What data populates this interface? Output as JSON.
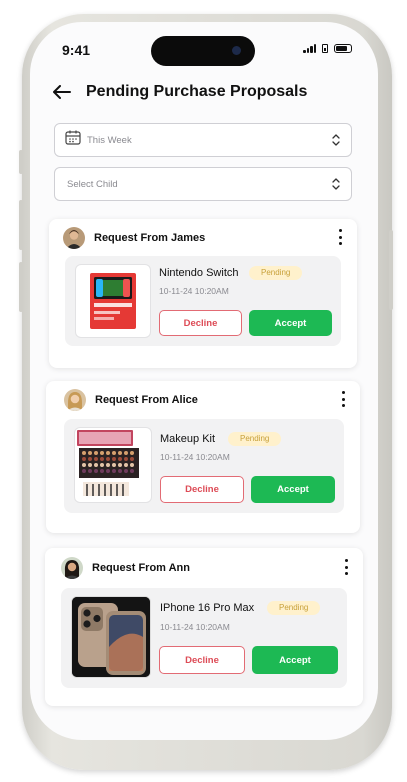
{
  "status_bar": {
    "time": "9:41"
  },
  "header": {
    "title": "Pending Purchase Proposals"
  },
  "filters": {
    "week": {
      "value": "This Week"
    },
    "child": {
      "placeholder": "Select Child"
    }
  },
  "requests": [
    {
      "requester": "Request From James",
      "product": "Nintendo Switch",
      "status": "Pending",
      "datetime": "10-11-24 10:20AM",
      "decline_label": "Decline",
      "accept_label": "Accept"
    },
    {
      "requester": "Request From Alice",
      "product": "Makeup Kit",
      "status": "Pending",
      "datetime": "10-11-24 10:20AM",
      "decline_label": "Decline",
      "accept_label": "Accept"
    },
    {
      "requester": "Request From Ann",
      "product": "IPhone 16 Pro Max",
      "status": "Pending",
      "datetime": "10-11-24 10:20AM",
      "decline_label": "Decline",
      "accept_label": "Accept"
    }
  ],
  "colors": {
    "accept": "#1db954",
    "decline": "#dd4b56",
    "pending_bg": "#fff1cc",
    "pending_text": "#c8a13a"
  }
}
